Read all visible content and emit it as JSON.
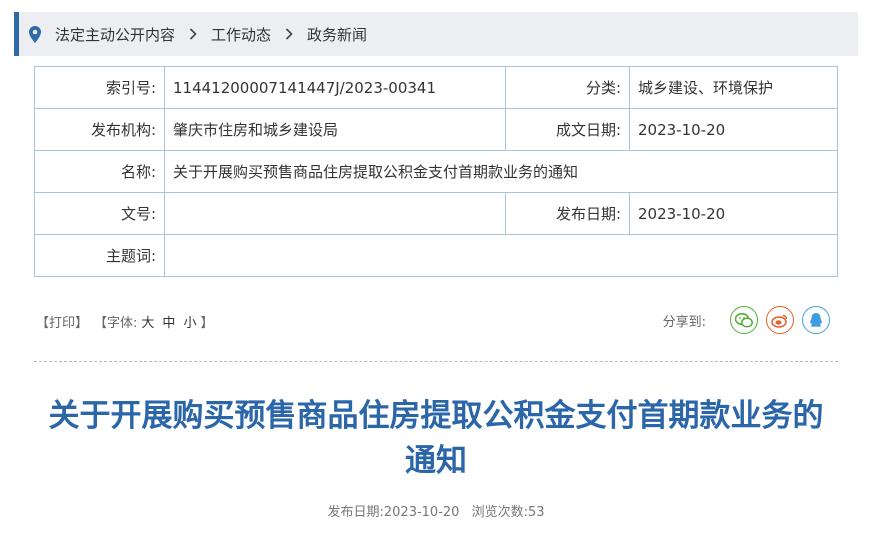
{
  "breadcrumb": {
    "items": [
      "法定主动公开内容",
      "工作动态",
      "政务新闻"
    ]
  },
  "meta": {
    "index_label": "索引号:",
    "index_value": "11441200007141447J/2023-00341",
    "category_label": "分类:",
    "category_value": "城乡建设、环境保护",
    "publisher_label": "发布机构:",
    "publisher_value": "肇庆市住房和城乡建设局",
    "written_date_label": "成文日期:",
    "written_date_value": "2023-10-20",
    "name_label": "名称:",
    "name_value": "关于开展购买预售商品住房提取公积金支付首期款业务的通知",
    "doc_no_label": "文号:",
    "doc_no_value": "",
    "publish_date_label": "发布日期:",
    "publish_date_value": "2023-10-20",
    "keywords_label": "主题词:",
    "keywords_value": ""
  },
  "tools": {
    "print_label": "【打印】",
    "font_prefix": "【字体:",
    "font_large": "大",
    "font_medium": "中",
    "font_small": "小",
    "font_suffix": "】"
  },
  "share": {
    "label": "分享到:",
    "icons": [
      "wechat-icon",
      "weibo-icon",
      "qq-icon"
    ],
    "colors": {
      "wechat": "#4cae33",
      "weibo": "#e4612a",
      "qq": "#3d9ee1"
    }
  },
  "article": {
    "title_line1": "关于开展购买预售商品住房提取公积金支付首期款业务的",
    "title_line2": "通知",
    "date_label": "发布日期:",
    "date_value": "2023-10-20",
    "views_label": "浏览次数:",
    "views_value": "53"
  },
  "colors": {
    "accent": "#2d6aa6",
    "title": "#2b66a8",
    "table_border": "#a9c3d9"
  }
}
